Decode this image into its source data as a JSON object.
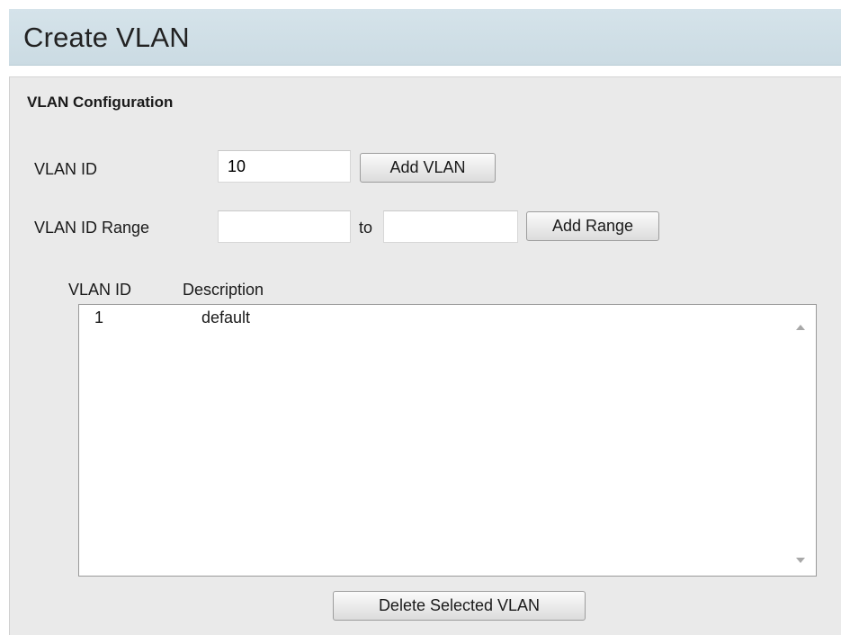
{
  "page": {
    "title": "Create VLAN"
  },
  "config": {
    "section_title": "VLAN Configuration",
    "vlan_id_label": "VLAN ID",
    "vlan_id_value": "10",
    "add_vlan_label": "Add VLAN",
    "range_label": "VLAN ID Range",
    "range_from_value": "",
    "to_label": "to",
    "range_to_value": "",
    "add_range_label": "Add Range"
  },
  "table": {
    "columns": [
      "VLAN ID",
      "Description"
    ],
    "rows": [
      {
        "vlan_id": "1",
        "description": "default"
      }
    ]
  },
  "actions": {
    "delete_label": "Delete Selected VLAN"
  },
  "icons": {
    "scroll_up": "scroll-up-arrow-icon",
    "scroll_down": "scroll-down-arrow-icon"
  }
}
